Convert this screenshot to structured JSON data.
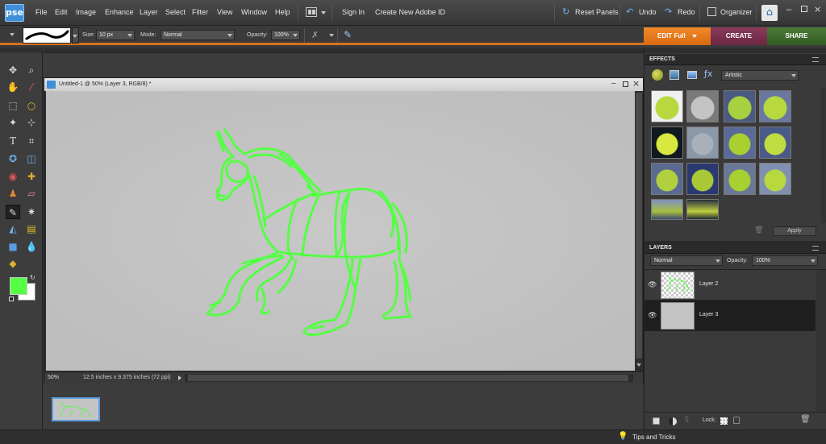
{
  "app": {
    "logo": "pse",
    "menu": [
      "File",
      "Edit",
      "Image",
      "Enhance",
      "Layer",
      "Select",
      "Filter",
      "View",
      "Window",
      "Help"
    ],
    "sign_in": "Sign In",
    "create_id": "Create New Adobe ID",
    "reset_panels": "Reset Panels",
    "undo": "Undo",
    "redo": "Redo",
    "organizer": "Organizer"
  },
  "options": {
    "size_label": "Size:",
    "size_value": "10 px",
    "mode_label": "Mode:",
    "mode_value": "Normal",
    "opacity_label": "Opacity:",
    "opacity_value": "100%"
  },
  "modes": {
    "edit": "EDIT Full",
    "create": "CREATE",
    "share": "SHARE"
  },
  "document": {
    "title": "Untitled-1 @ 50% (Layer 3, RGB/8) *",
    "zoom": "50%",
    "info": "12.5 inches x 9.375 inches (72 ppi)"
  },
  "effects": {
    "header": "EFFECTS",
    "category": "Artistic",
    "apply": "Apply"
  },
  "layers": {
    "header": "LAYERS",
    "blend": "Normal",
    "opacity_label": "Opacity:",
    "opacity_value": "100%",
    "lock_label": "Lock:",
    "items": [
      {
        "name": "Layer 2"
      },
      {
        "name": "Layer 3"
      }
    ]
  },
  "footer": {
    "tips": "Tips and Tricks"
  },
  "colors": {
    "accent": "#d8731a",
    "foreground": "#55ff44",
    "background": "#ffffff",
    "create_tab": "#7a2f4f",
    "share_tab": "#3f6b2e"
  }
}
